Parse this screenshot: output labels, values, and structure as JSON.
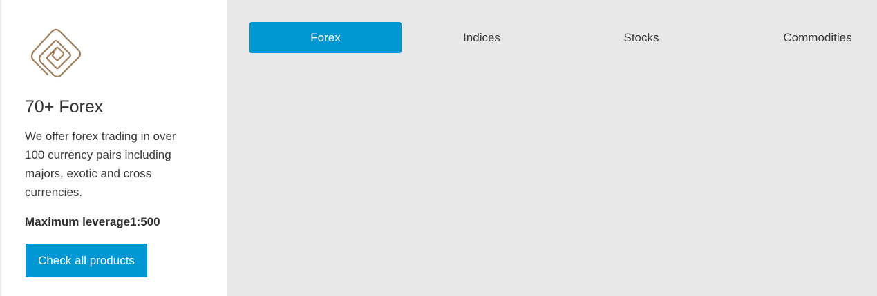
{
  "product": {
    "icon": "forex-spiral-icon",
    "icon_color": "#a07b58",
    "title": "70+ Forex",
    "description": "We offer forex trading in over 100 currency pairs including majors, exotic and cross currencies.",
    "leverage": "Maximum leverage1:500",
    "cta_label": "Check all products"
  },
  "tabs": [
    {
      "label": "Forex",
      "active": true
    },
    {
      "label": "Indices",
      "active": false
    },
    {
      "label": "Stocks",
      "active": false
    },
    {
      "label": "Commodities",
      "active": false
    }
  ],
  "colors": {
    "accent": "#0098d4",
    "panel_bg": "#ffffff",
    "page_bg": "#e8e8e8"
  }
}
